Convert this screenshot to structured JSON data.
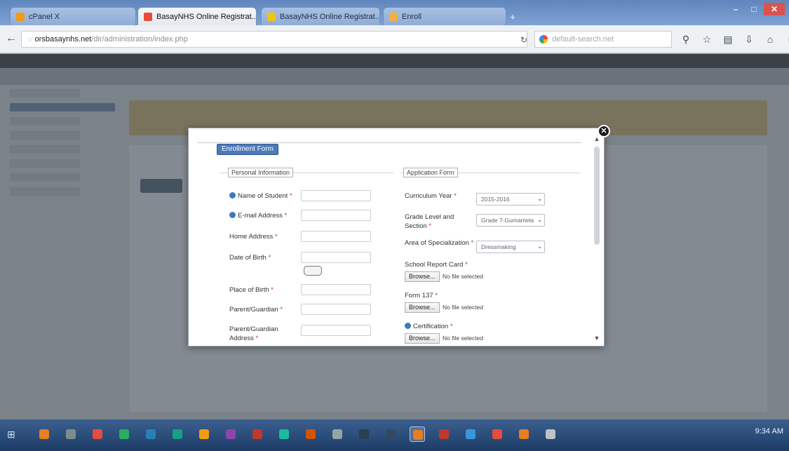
{
  "browser": {
    "tabs": [
      {
        "label": "cPanel X",
        "favicon_color": "#f39c12"
      },
      {
        "label": "BasayNHS Online Registrat...",
        "favicon_color": "#e74c3c",
        "active": true
      },
      {
        "label": "BasayNHS Online Registrat...",
        "favicon_color": "#f1c40f"
      },
      {
        "label": "Enroll",
        "favicon_color": "#f5b041"
      }
    ],
    "tab_close": "x",
    "url_host": "orsbasaynhs.net",
    "url_path": "/dir/administration/index.php",
    "search_placeholder": "default-search.net"
  },
  "modal": {
    "fieldset_legend": "Enrollment Form",
    "personal_legend": "Personal Information",
    "application_legend": "Application Form",
    "personal_fields": [
      {
        "label": "Name of Student",
        "required": "*",
        "info": true
      },
      {
        "label": "E-mail Address",
        "required": "*",
        "info": true
      },
      {
        "label": "Home Address",
        "required": "*",
        "info": false
      },
      {
        "label": "Date of Birth",
        "required": "*",
        "info": false
      },
      {
        "label": "Place of Birth",
        "required": "*",
        "info": false
      },
      {
        "label": "Parent/Guardian",
        "required": "*",
        "info": false
      },
      {
        "label": "Parent/Guardian Address",
        "required": "*",
        "info": false
      }
    ],
    "curriculum": {
      "label": "Curriculum Year",
      "required": "*",
      "value": "2015-2016"
    },
    "grade": {
      "label": "Grade Level and Section",
      "required": "*",
      "value": "Grade 7-Gumamela"
    },
    "specialization": {
      "label": "Area of Specialization",
      "required": "*",
      "value": "Dressmaking"
    },
    "uploads": [
      {
        "label": "School Report Card",
        "required": "*",
        "info": false,
        "button": "Browse...",
        "status": "No file selected"
      },
      {
        "label": "Form 137",
        "required": "*",
        "info": false,
        "button": "Browse...",
        "status": "No file selected"
      },
      {
        "label": "Certification",
        "required": "*",
        "info": true,
        "button": "Browse...",
        "status": "No file selected"
      }
    ]
  },
  "taskbar": {
    "clock": "9:34 AM",
    "icons": [
      "#e67e22",
      "#7f8c8d",
      "#e74c3c",
      "#27ae60",
      "#2980b9",
      "#16a085",
      "#f39c12",
      "#8e44ad",
      "#c0392b",
      "#1abc9c",
      "#d35400",
      "#95a5a6",
      "#2c3e50",
      "#34495e",
      "#e67e22",
      "#c0392b",
      "#3498db",
      "#e74c3c",
      "#e67e22",
      "#bdc3c7"
    ]
  }
}
